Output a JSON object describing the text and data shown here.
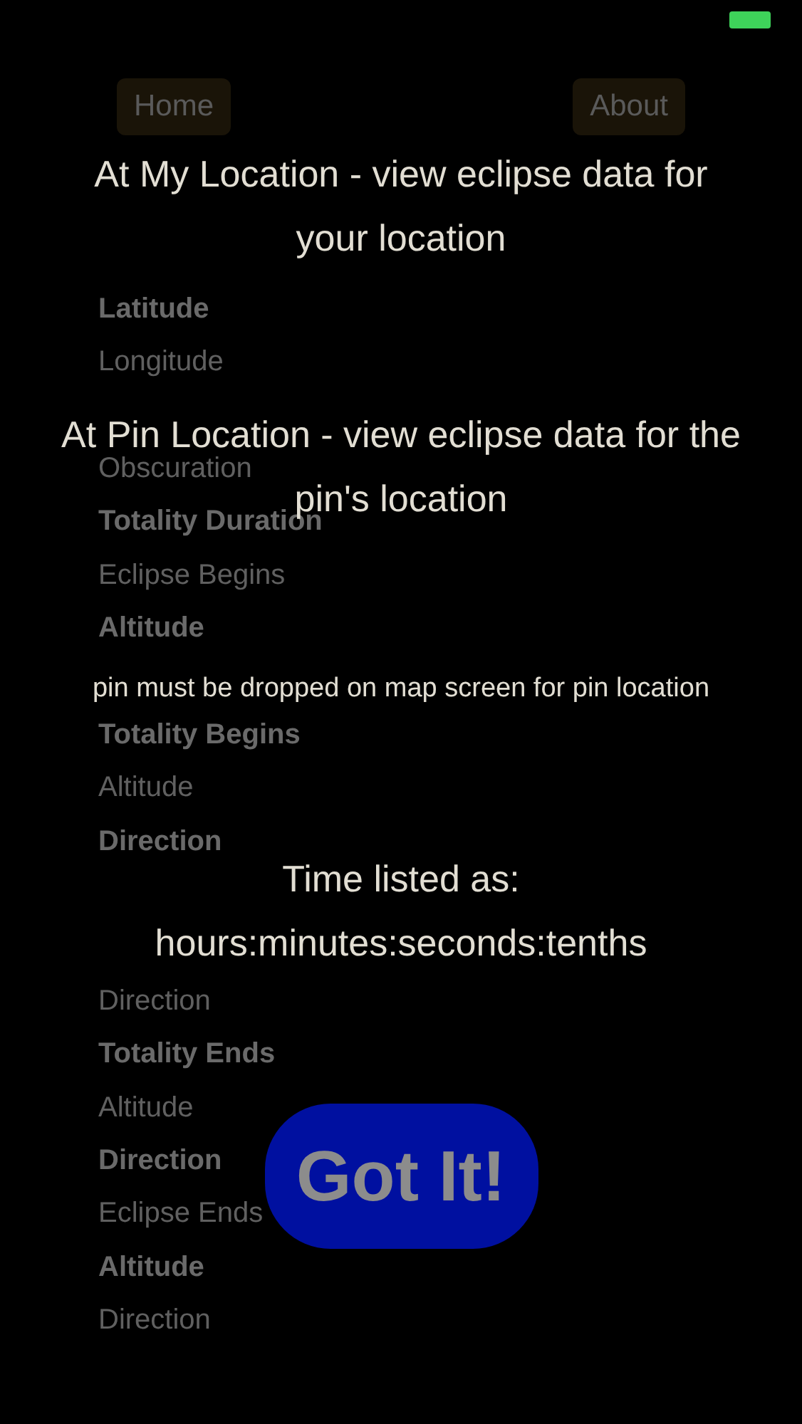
{
  "nav_buttons": [
    {
      "label": "Home"
    },
    {
      "label": "About"
    }
  ],
  "rows": [
    {
      "label": "Latitude",
      "kind": "heading"
    },
    {
      "label": "Longitude",
      "kind": "value"
    },
    {
      "kind": "covered"
    },
    {
      "label": "Obscuration",
      "kind": "value"
    },
    {
      "label": "Totality Duration",
      "kind": "heading"
    },
    {
      "label": "Eclipse Begins",
      "kind": "value"
    },
    {
      "label": "Altitude",
      "kind": "heading"
    },
    {
      "kind": "covered"
    },
    {
      "label": "Totality Begins",
      "kind": "heading"
    },
    {
      "label": "Altitude",
      "kind": "value"
    },
    {
      "label": "Direction",
      "kind": "heading"
    },
    {
      "kind": "covered"
    },
    {
      "kind": "covered"
    },
    {
      "label": "Direction",
      "kind": "value"
    },
    {
      "label": "Totality Ends",
      "kind": "heading"
    },
    {
      "label": "Altitude",
      "kind": "value"
    },
    {
      "label": "Direction",
      "kind": "heading"
    },
    {
      "label": "Eclipse Ends",
      "kind": "value"
    },
    {
      "label": "Altitude",
      "kind": "heading"
    },
    {
      "label": "Direction",
      "kind": "value"
    }
  ],
  "overlay": {
    "tips": [
      {
        "lines": [
          "At My Location - view eclipse data for",
          "your location"
        ],
        "kind": "large"
      },
      {
        "lines": [
          "At Pin Location - view eclipse data for the",
          "pin's location"
        ],
        "kind": "large"
      },
      {
        "lines": [
          "pin must be dropped on map screen for pin location"
        ],
        "kind": "small"
      },
      {
        "lines": [
          "Time listed as:",
          "hours:minutes:seconds:tenths"
        ],
        "kind": "large"
      }
    ],
    "button": "Got It!"
  }
}
